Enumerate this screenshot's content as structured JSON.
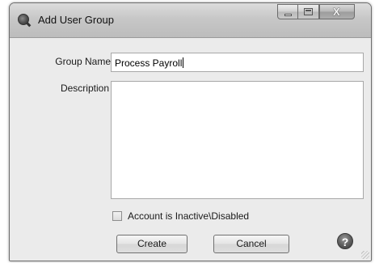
{
  "window": {
    "title": "Add User Group",
    "controls": {
      "minimize_icon": "minimize-icon",
      "maximize_icon": "maximize-icon",
      "close_glyph": "X"
    }
  },
  "form": {
    "group_name_label": "Group Name",
    "group_name_value": "Process Payroll",
    "description_label": "Description",
    "description_value": "",
    "inactive_checkbox_label": "Account is Inactive\\Disabled",
    "inactive_checked": false
  },
  "buttons": {
    "create_label": "Create",
    "cancel_label": "Cancel",
    "help_glyph": "?"
  },
  "icons": {
    "app": "magnifier-app-icon",
    "help": "help-icon"
  }
}
